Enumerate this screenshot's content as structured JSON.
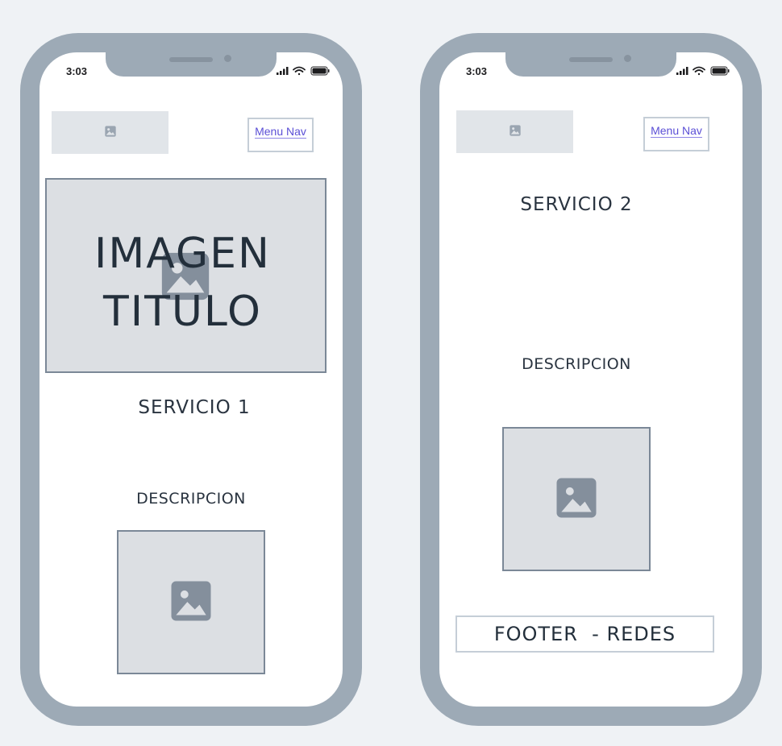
{
  "colors": {
    "frame": "#9daab6",
    "background": "#eff2f5",
    "placeholder": "#dcdfe3",
    "link": "#5b4fd6",
    "text": "#2a3440"
  },
  "phones": [
    {
      "status": {
        "time": "3:03"
      },
      "logo_icon": "image-icon",
      "menu_label": "Menu Nav",
      "hero": {
        "title_line1": "IMAGEN",
        "title_line2": "TITULO",
        "icon": "image-icon"
      },
      "service_title": "SERVICIO 1",
      "description": "DESCRIPCION",
      "image_icon": "image-icon"
    },
    {
      "status": {
        "time": "3:03"
      },
      "logo_icon": "image-icon",
      "menu_label": "Menu Nav",
      "service_title": "SERVICIO 2",
      "description": "DESCRIPCION",
      "image_icon": "image-icon",
      "footer_label": "FOOTER  - REDES"
    }
  ]
}
